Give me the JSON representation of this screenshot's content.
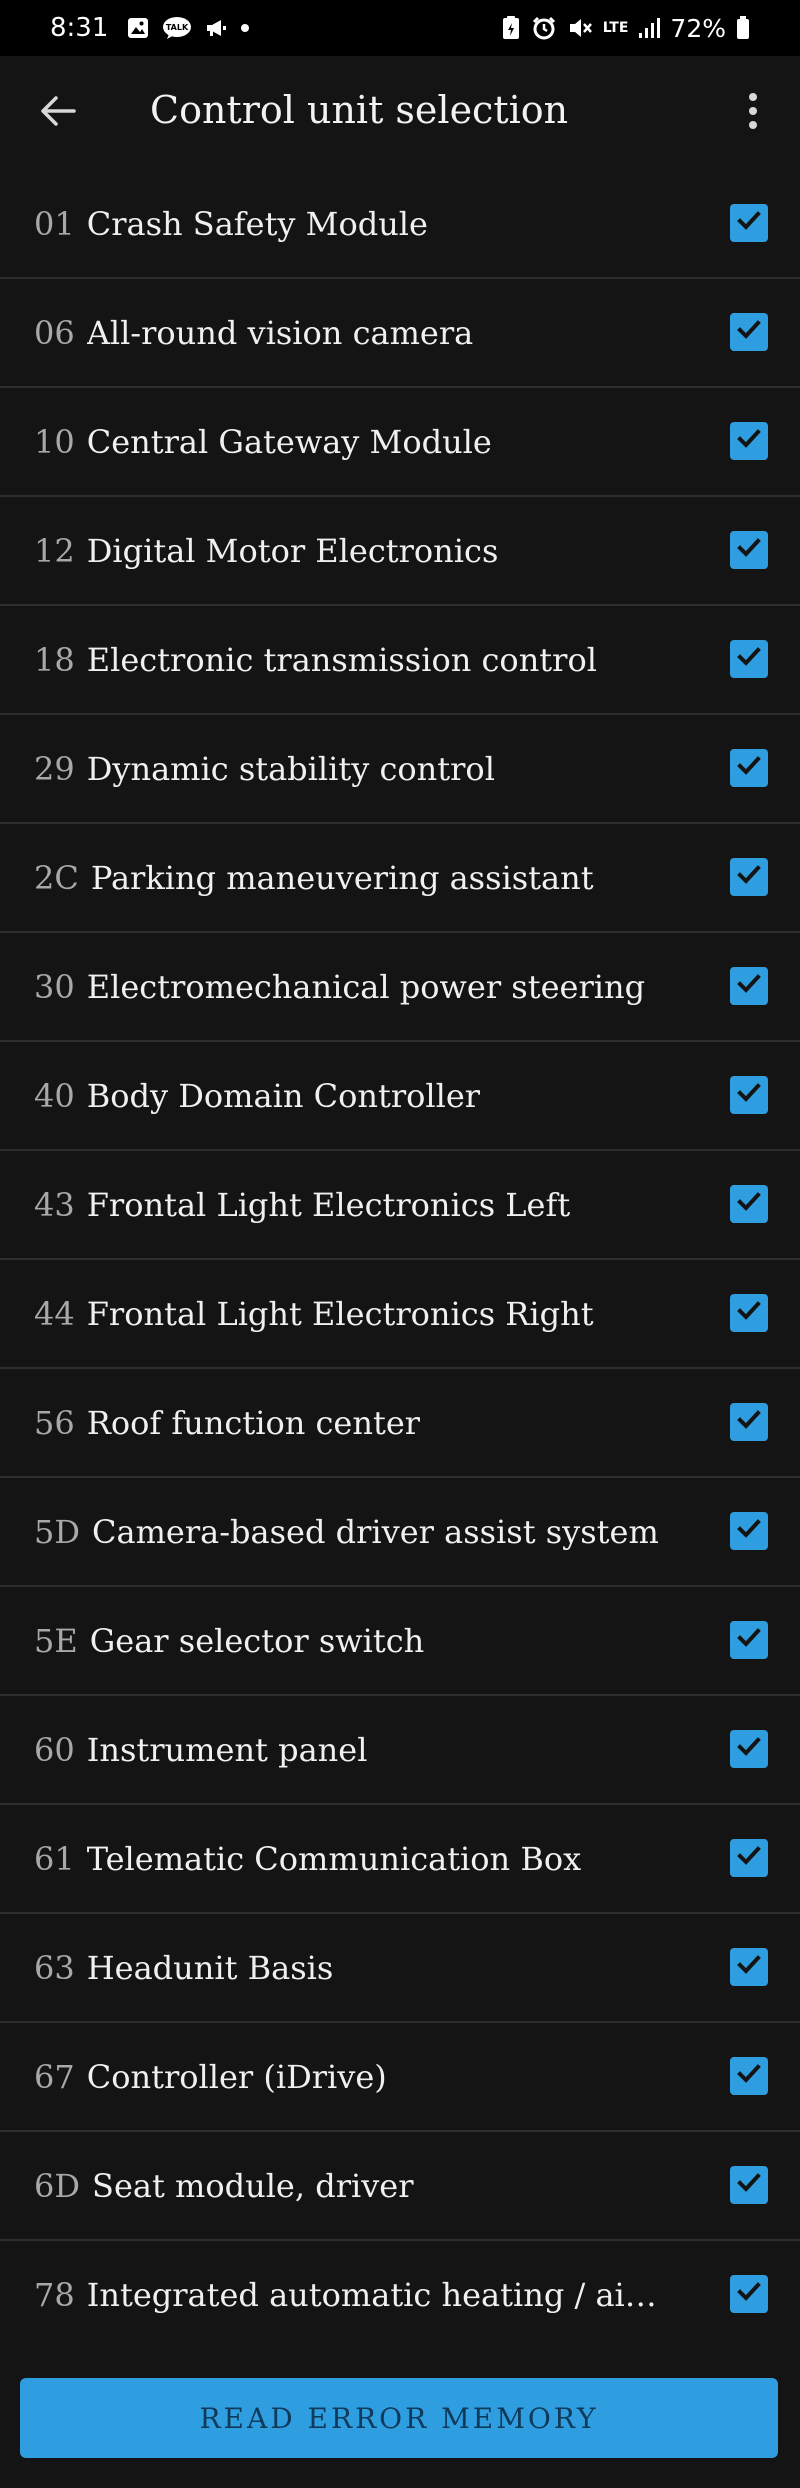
{
  "status_bar": {
    "time": "8:31",
    "network": "LTE",
    "battery": "72%"
  },
  "app_bar": {
    "title": "Control unit selection"
  },
  "colors": {
    "accent": "#2e9ee0",
    "background": "#141414",
    "divider": "#2e2e2e",
    "code_text": "#a8a8a8"
  },
  "units": [
    {
      "code": "01",
      "name": "Crash Safety Module",
      "checked": true
    },
    {
      "code": "06",
      "name": "All-round vision camera",
      "checked": true
    },
    {
      "code": "10",
      "name": "Central Gateway Module",
      "checked": true
    },
    {
      "code": "12",
      "name": "Digital Motor Electronics",
      "checked": true
    },
    {
      "code": "18",
      "name": "Electronic transmission control",
      "checked": true
    },
    {
      "code": "29",
      "name": "Dynamic stability control",
      "checked": true
    },
    {
      "code": "2C",
      "name": "Parking maneuvering assistant",
      "checked": true
    },
    {
      "code": "30",
      "name": "Electromechanical power steering",
      "checked": true
    },
    {
      "code": "40",
      "name": "Body Domain Controller",
      "checked": true
    },
    {
      "code": "43",
      "name": "Frontal Light Electronics Left",
      "checked": true
    },
    {
      "code": "44",
      "name": "Frontal Light Electronics Right",
      "checked": true
    },
    {
      "code": "56",
      "name": "Roof function center",
      "checked": true
    },
    {
      "code": "5D",
      "name": "Camera-based driver assist system",
      "checked": true
    },
    {
      "code": "5E",
      "name": "Gear selector switch",
      "checked": true
    },
    {
      "code": "60",
      "name": "Instrument panel",
      "checked": true
    },
    {
      "code": "61",
      "name": "Telematic Communication Box",
      "checked": true
    },
    {
      "code": "63",
      "name": "Headunit Basis",
      "checked": true
    },
    {
      "code": "67",
      "name": "Controller (iDrive)",
      "checked": true
    },
    {
      "code": "6D",
      "name": "Seat module, driver",
      "checked": true
    },
    {
      "code": "78",
      "name": "Integrated automatic heating / air cond…",
      "checked": true
    }
  ],
  "actions": {
    "read_error_memory": "READ ERROR MEMORY"
  },
  "icons": {
    "back": "arrow-left-icon",
    "menu": "more-vertical-icon",
    "checkbox": "checkmark-icon"
  }
}
